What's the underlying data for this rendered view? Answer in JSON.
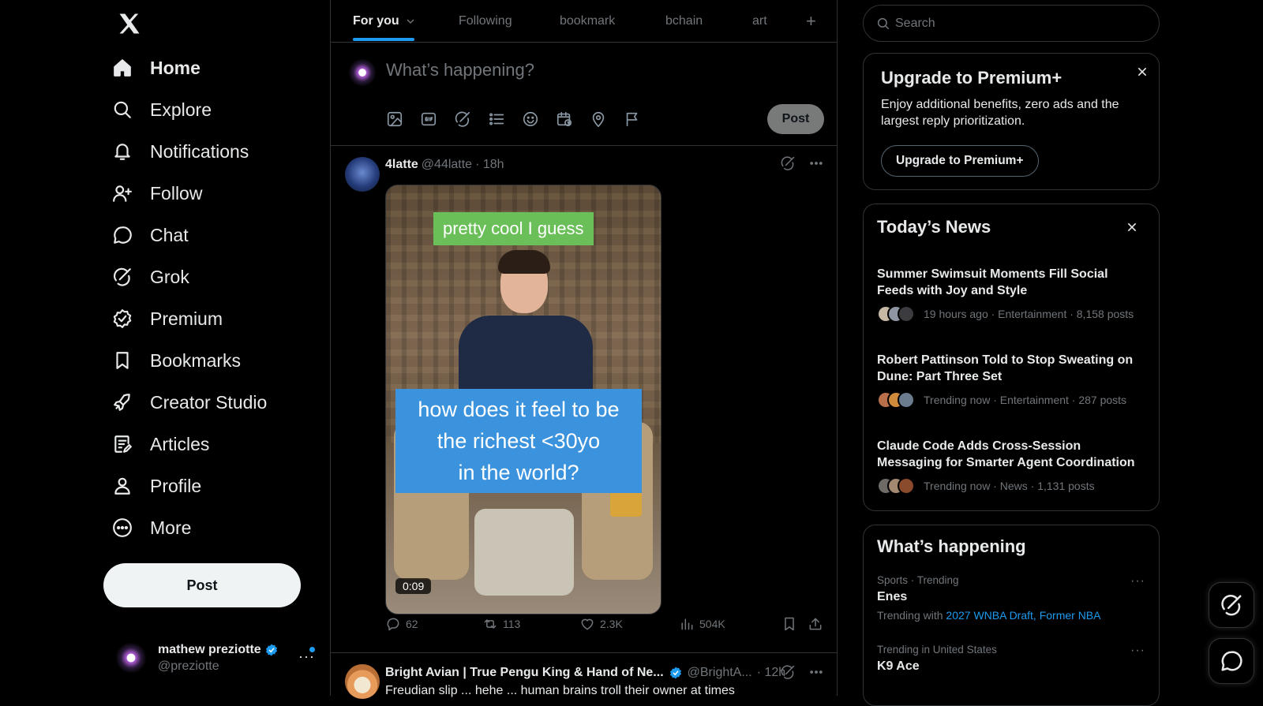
{
  "nav": {
    "items": [
      {
        "label": "Home",
        "icon": "home-icon"
      },
      {
        "label": "Explore",
        "icon": "search-icon"
      },
      {
        "label": "Notifications",
        "icon": "bell-icon"
      },
      {
        "label": "Follow",
        "icon": "person-add-icon"
      },
      {
        "label": "Chat",
        "icon": "chat-bubble-icon"
      },
      {
        "label": "Grok",
        "icon": "grok-icon"
      },
      {
        "label": "Premium",
        "icon": "verified-badge-icon"
      },
      {
        "label": "Bookmarks",
        "icon": "bookmark-icon"
      },
      {
        "label": "Creator Studio",
        "icon": "rocket-icon"
      },
      {
        "label": "Articles",
        "icon": "article-icon"
      },
      {
        "label": "Profile",
        "icon": "person-icon"
      },
      {
        "label": "More",
        "icon": "more-circle-icon"
      }
    ],
    "post_label": "Post"
  },
  "account": {
    "name": "mathew preziotte",
    "handle": "@preziotte",
    "more": "···"
  },
  "tabs": [
    {
      "label": "For you",
      "active": true
    },
    {
      "label": "Following"
    },
    {
      "label": "bookmark"
    },
    {
      "label": "bchain"
    },
    {
      "label": "art"
    },
    {
      "label": "+"
    }
  ],
  "composer": {
    "placeholder": "What’s happening?",
    "post_label": "Post"
  },
  "tweet1": {
    "name": "4latte",
    "handle": "@44latte",
    "time": "· 18h",
    "caption_top": "pretty cool I guess",
    "caption_main": [
      "how does it feel to be",
      "the richest <30yo",
      "in the world?"
    ],
    "duration": "0:09",
    "replies": "62",
    "reposts": "113",
    "likes": "2.3K",
    "views": "504K"
  },
  "tweet2": {
    "name": "Bright Avian | True Pengu King & Hand of Ne...",
    "handle": "@BrightA...",
    "time": "· 12h",
    "text": "Freudian slip ... hehe ... human brains troll their owner at times"
  },
  "search": {
    "placeholder": "Search"
  },
  "premium": {
    "title": "Upgrade to Premium+",
    "body": "Enjoy additional benefits, zero ads and the largest reply prioritization.",
    "button": "Upgrade to Premium+"
  },
  "news": {
    "title": "Today’s News",
    "items": [
      {
        "title": "Summer Swimsuit Moments Fill Social Feeds with Joy and Style",
        "meta": "19 hours ago · Entertainment · 8,158 posts"
      },
      {
        "title": "Robert Pattinson Told to Stop Sweating on Dune: Part Three Set",
        "meta": "Trending now · Entertainment · 287 posts"
      },
      {
        "title": "Claude Code Adds Cross-Session Messaging for Smarter Agent Coordination",
        "meta": "Trending now · News · 1,131 posts"
      }
    ]
  },
  "happening": {
    "title": "What’s happening",
    "items": [
      {
        "category": "Sports · Trending",
        "title": "Enes",
        "sub_prefix": "Trending with",
        "sub_links": "2027 WNBA Draft, Former NBA"
      },
      {
        "category": "Trending in United States",
        "title": "K9 Ace"
      }
    ]
  },
  "colors": {
    "accent": "#1d9bf0",
    "background": "#000000",
    "border": "#2f3336",
    "muted": "#71767b"
  }
}
